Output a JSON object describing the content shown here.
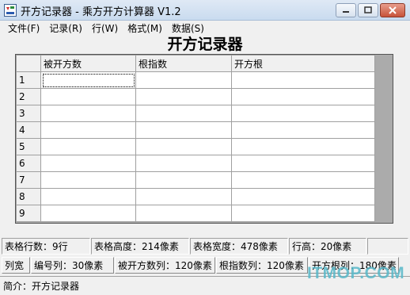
{
  "window": {
    "title": "开方记录器 - 乘方开方计算器 V1.2",
    "icon": "app-icon",
    "buttons": [
      "minimize-icon",
      "maximize-icon",
      "close-icon"
    ]
  },
  "menu": [
    {
      "label": "文件(F)"
    },
    {
      "label": "记录(R)"
    },
    {
      "label": "行(W)"
    },
    {
      "label": "格式(M)"
    },
    {
      "label": "数据(S)"
    }
  ],
  "heading": "开方记录器",
  "grid": {
    "columns": [
      "被开方数",
      "根指数",
      "开方根"
    ],
    "rows": [
      {
        "num": "1",
        "cells": [
          "",
          "",
          ""
        ]
      },
      {
        "num": "2",
        "cells": [
          "",
          "",
          ""
        ]
      },
      {
        "num": "3",
        "cells": [
          "",
          "",
          ""
        ]
      },
      {
        "num": "4",
        "cells": [
          "",
          "",
          ""
        ]
      },
      {
        "num": "5",
        "cells": [
          "",
          "",
          ""
        ]
      },
      {
        "num": "6",
        "cells": [
          "",
          "",
          ""
        ]
      },
      {
        "num": "7",
        "cells": [
          "",
          "",
          ""
        ]
      },
      {
        "num": "8",
        "cells": [
          "",
          "",
          ""
        ]
      },
      {
        "num": "9",
        "cells": [
          "",
          "",
          ""
        ]
      }
    ]
  },
  "status_row1": [
    "表格行数：9行",
    "表格高度：214像素",
    "表格宽度：478像素",
    "行高：20像素",
    ""
  ],
  "status_row2": [
    "列宽",
    "编号列：30像素",
    "被开方数列：120像素",
    "根指数列：120像素",
    "开方根列：180像素"
  ],
  "footer": "简介：开方记录器",
  "watermark": "ITMOP.COM"
}
